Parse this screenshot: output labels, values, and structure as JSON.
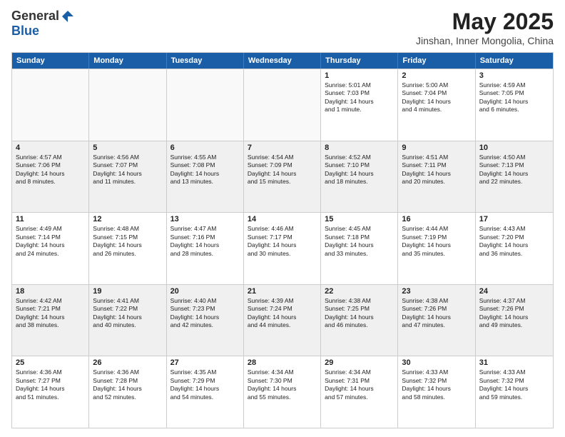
{
  "logo": {
    "general": "General",
    "blue": "Blue"
  },
  "title": "May 2025",
  "subtitle": "Jinshan, Inner Mongolia, China",
  "days": [
    "Sunday",
    "Monday",
    "Tuesday",
    "Wednesday",
    "Thursday",
    "Friday",
    "Saturday"
  ],
  "weeks": [
    [
      {
        "day": "",
        "lines": []
      },
      {
        "day": "",
        "lines": []
      },
      {
        "day": "",
        "lines": []
      },
      {
        "day": "",
        "lines": []
      },
      {
        "day": "1",
        "lines": [
          "Sunrise: 5:01 AM",
          "Sunset: 7:03 PM",
          "Daylight: 14 hours",
          "and 1 minute."
        ]
      },
      {
        "day": "2",
        "lines": [
          "Sunrise: 5:00 AM",
          "Sunset: 7:04 PM",
          "Daylight: 14 hours",
          "and 4 minutes."
        ]
      },
      {
        "day": "3",
        "lines": [
          "Sunrise: 4:59 AM",
          "Sunset: 7:05 PM",
          "Daylight: 14 hours",
          "and 6 minutes."
        ]
      }
    ],
    [
      {
        "day": "4",
        "lines": [
          "Sunrise: 4:57 AM",
          "Sunset: 7:06 PM",
          "Daylight: 14 hours",
          "and 8 minutes."
        ]
      },
      {
        "day": "5",
        "lines": [
          "Sunrise: 4:56 AM",
          "Sunset: 7:07 PM",
          "Daylight: 14 hours",
          "and 11 minutes."
        ]
      },
      {
        "day": "6",
        "lines": [
          "Sunrise: 4:55 AM",
          "Sunset: 7:08 PM",
          "Daylight: 14 hours",
          "and 13 minutes."
        ]
      },
      {
        "day": "7",
        "lines": [
          "Sunrise: 4:54 AM",
          "Sunset: 7:09 PM",
          "Daylight: 14 hours",
          "and 15 minutes."
        ]
      },
      {
        "day": "8",
        "lines": [
          "Sunrise: 4:52 AM",
          "Sunset: 7:10 PM",
          "Daylight: 14 hours",
          "and 18 minutes."
        ]
      },
      {
        "day": "9",
        "lines": [
          "Sunrise: 4:51 AM",
          "Sunset: 7:11 PM",
          "Daylight: 14 hours",
          "and 20 minutes."
        ]
      },
      {
        "day": "10",
        "lines": [
          "Sunrise: 4:50 AM",
          "Sunset: 7:13 PM",
          "Daylight: 14 hours",
          "and 22 minutes."
        ]
      }
    ],
    [
      {
        "day": "11",
        "lines": [
          "Sunrise: 4:49 AM",
          "Sunset: 7:14 PM",
          "Daylight: 14 hours",
          "and 24 minutes."
        ]
      },
      {
        "day": "12",
        "lines": [
          "Sunrise: 4:48 AM",
          "Sunset: 7:15 PM",
          "Daylight: 14 hours",
          "and 26 minutes."
        ]
      },
      {
        "day": "13",
        "lines": [
          "Sunrise: 4:47 AM",
          "Sunset: 7:16 PM",
          "Daylight: 14 hours",
          "and 28 minutes."
        ]
      },
      {
        "day": "14",
        "lines": [
          "Sunrise: 4:46 AM",
          "Sunset: 7:17 PM",
          "Daylight: 14 hours",
          "and 30 minutes."
        ]
      },
      {
        "day": "15",
        "lines": [
          "Sunrise: 4:45 AM",
          "Sunset: 7:18 PM",
          "Daylight: 14 hours",
          "and 33 minutes."
        ]
      },
      {
        "day": "16",
        "lines": [
          "Sunrise: 4:44 AM",
          "Sunset: 7:19 PM",
          "Daylight: 14 hours",
          "and 35 minutes."
        ]
      },
      {
        "day": "17",
        "lines": [
          "Sunrise: 4:43 AM",
          "Sunset: 7:20 PM",
          "Daylight: 14 hours",
          "and 36 minutes."
        ]
      }
    ],
    [
      {
        "day": "18",
        "lines": [
          "Sunrise: 4:42 AM",
          "Sunset: 7:21 PM",
          "Daylight: 14 hours",
          "and 38 minutes."
        ]
      },
      {
        "day": "19",
        "lines": [
          "Sunrise: 4:41 AM",
          "Sunset: 7:22 PM",
          "Daylight: 14 hours",
          "and 40 minutes."
        ]
      },
      {
        "day": "20",
        "lines": [
          "Sunrise: 4:40 AM",
          "Sunset: 7:23 PM",
          "Daylight: 14 hours",
          "and 42 minutes."
        ]
      },
      {
        "day": "21",
        "lines": [
          "Sunrise: 4:39 AM",
          "Sunset: 7:24 PM",
          "Daylight: 14 hours",
          "and 44 minutes."
        ]
      },
      {
        "day": "22",
        "lines": [
          "Sunrise: 4:38 AM",
          "Sunset: 7:25 PM",
          "Daylight: 14 hours",
          "and 46 minutes."
        ]
      },
      {
        "day": "23",
        "lines": [
          "Sunrise: 4:38 AM",
          "Sunset: 7:26 PM",
          "Daylight: 14 hours",
          "and 47 minutes."
        ]
      },
      {
        "day": "24",
        "lines": [
          "Sunrise: 4:37 AM",
          "Sunset: 7:26 PM",
          "Daylight: 14 hours",
          "and 49 minutes."
        ]
      }
    ],
    [
      {
        "day": "25",
        "lines": [
          "Sunrise: 4:36 AM",
          "Sunset: 7:27 PM",
          "Daylight: 14 hours",
          "and 51 minutes."
        ]
      },
      {
        "day": "26",
        "lines": [
          "Sunrise: 4:36 AM",
          "Sunset: 7:28 PM",
          "Daylight: 14 hours",
          "and 52 minutes."
        ]
      },
      {
        "day": "27",
        "lines": [
          "Sunrise: 4:35 AM",
          "Sunset: 7:29 PM",
          "Daylight: 14 hours",
          "and 54 minutes."
        ]
      },
      {
        "day": "28",
        "lines": [
          "Sunrise: 4:34 AM",
          "Sunset: 7:30 PM",
          "Daylight: 14 hours",
          "and 55 minutes."
        ]
      },
      {
        "day": "29",
        "lines": [
          "Sunrise: 4:34 AM",
          "Sunset: 7:31 PM",
          "Daylight: 14 hours",
          "and 57 minutes."
        ]
      },
      {
        "day": "30",
        "lines": [
          "Sunrise: 4:33 AM",
          "Sunset: 7:32 PM",
          "Daylight: 14 hours",
          "and 58 minutes."
        ]
      },
      {
        "day": "31",
        "lines": [
          "Sunrise: 4:33 AM",
          "Sunset: 7:32 PM",
          "Daylight: 14 hours",
          "and 59 minutes."
        ]
      }
    ]
  ]
}
